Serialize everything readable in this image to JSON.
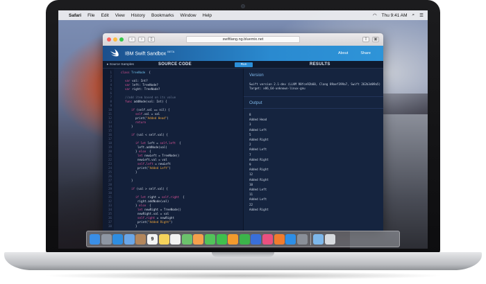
{
  "menubar": {
    "app_name": "Safari",
    "items": [
      "File",
      "Edit",
      "View",
      "History",
      "Bookmarks",
      "Window",
      "Help"
    ],
    "clock": "Thu 9:41 AM"
  },
  "safari": {
    "url": "swiftlang.ng.bluemix.net"
  },
  "sandbox": {
    "title": "IBM Swift Sandbox",
    "beta": "BETA",
    "nav": [
      "About",
      "Share"
    ],
    "samples_label": "Source Samples",
    "source_label": "SOURCE CODE",
    "run_label": "Run",
    "results_label": "RESULTS"
  },
  "code_lines": [
    {
      "n": "1",
      "t": [
        [
          "kw",
          "class "
        ],
        [
          "ty",
          "TreeNode"
        ],
        [
          "",
          "  {"
        ]
      ],
      "i": 2
    },
    {
      "n": "2",
      "t": [
        [
          "",
          ""
        ]
      ],
      "i": 0
    },
    {
      "n": "3",
      "t": [
        [
          "kw",
          "var "
        ],
        [
          "",
          "val: Int?"
        ]
      ],
      "i": 4
    },
    {
      "n": "4",
      "t": [
        [
          "kw",
          "var "
        ],
        [
          "",
          "left: TreeNode?"
        ]
      ],
      "i": 4
    },
    {
      "n": "5",
      "t": [
        [
          "kw",
          "var "
        ],
        [
          "",
          "right: TreeNode?"
        ]
      ],
      "i": 4
    },
    {
      "n": "6",
      "t": [
        [
          "",
          ""
        ]
      ],
      "i": 0
    },
    {
      "n": "7",
      "t": [
        [
          "cm",
          "//add item based on its value"
        ]
      ],
      "i": 4
    },
    {
      "n": "8",
      "t": [
        [
          "kw",
          "func "
        ],
        [
          "",
          "addNode(val: Int) {"
        ]
      ],
      "i": 4
    },
    {
      "n": "9",
      "t": [
        [
          "",
          ""
        ]
      ],
      "i": 0
    },
    {
      "n": "10",
      "t": [
        [
          "kw",
          "if "
        ],
        [
          "",
          "(self.val == nil) {"
        ]
      ],
      "i": 7
    },
    {
      "n": "11",
      "t": [
        [
          "sf",
          "self"
        ],
        [
          "",
          ".val = val"
        ]
      ],
      "i": 9
    },
    {
      "n": "12",
      "t": [
        [
          "",
          "print("
        ],
        [
          "st",
          "\"Added Head\""
        ],
        [
          "",
          ")"
        ]
      ],
      "i": 9
    },
    {
      "n": "13",
      "t": [
        [
          "kw",
          "return"
        ]
      ],
      "i": 9
    },
    {
      "n": "14",
      "t": [
        [
          "",
          "}"
        ]
      ],
      "i": 7
    },
    {
      "n": "15",
      "t": [
        [
          "",
          ""
        ]
      ],
      "i": 0
    },
    {
      "n": "16",
      "t": [
        [
          "kw",
          "if "
        ],
        [
          "",
          "(val < self.val) {"
        ]
      ],
      "i": 7
    },
    {
      "n": "17",
      "t": [
        [
          "",
          ""
        ]
      ],
      "i": 0
    },
    {
      "n": "18",
      "t": [
        [
          "kw",
          "if let "
        ],
        [
          "",
          "left = "
        ],
        [
          "sf",
          "self"
        ],
        [
          "",
          "."
        ],
        [
          "sf",
          "left"
        ],
        [
          "",
          "  {"
        ]
      ],
      "i": 9
    },
    {
      "n": "19",
      "t": [
        [
          "",
          "left.addNode(val)"
        ]
      ],
      "i": 10
    },
    {
      "n": "20",
      "t": [
        [
          "",
          "} "
        ],
        [
          "kw",
          "else"
        ],
        [
          "",
          "  {"
        ]
      ],
      "i": 9
    },
    {
      "n": "21",
      "t": [
        [
          "kw",
          "let "
        ],
        [
          "",
          "newLeft = TreeNode()"
        ]
      ],
      "i": 10
    },
    {
      "n": "22",
      "t": [
        [
          "",
          "newLeft.val = val"
        ]
      ],
      "i": 10
    },
    {
      "n": "23",
      "t": [
        [
          "sf",
          "self"
        ],
        [
          "",
          "."
        ],
        [
          "sf",
          "left"
        ],
        [
          "",
          ""
        ],
        [
          "",
          ""
        ],
        [
          "",
          ""
        ],
        [
          "",
          ""
        ]
      ],
      "i": 10,
      "suffix": " = newLeft"
    },
    {
      "n": "24",
      "t": [
        [
          "",
          "print("
        ],
        [
          "st",
          "\"Added Left\""
        ],
        [
          "",
          ")"
        ]
      ],
      "i": 10
    },
    {
      "n": "25",
      "t": [
        [
          "",
          "}"
        ]
      ],
      "i": 9
    },
    {
      "n": "26",
      "t": [
        [
          "",
          ""
        ]
      ],
      "i": 0
    },
    {
      "n": "27",
      "t": [
        [
          "",
          "}"
        ]
      ],
      "i": 7
    },
    {
      "n": "28",
      "t": [
        [
          "",
          ""
        ]
      ],
      "i": 0
    },
    {
      "n": "29",
      "t": [
        [
          "kw",
          "if "
        ],
        [
          "",
          "(val > self.val) {"
        ]
      ],
      "i": 7
    },
    {
      "n": "30",
      "t": [
        [
          "",
          ""
        ]
      ],
      "i": 0
    },
    {
      "n": "31",
      "t": [
        [
          "kw",
          "if let "
        ],
        [
          "",
          "right = "
        ],
        [
          "sf",
          "self"
        ],
        [
          "",
          "."
        ],
        [
          "sf",
          "right"
        ],
        [
          "",
          "  {"
        ]
      ],
      "i": 9
    },
    {
      "n": "32",
      "t": [
        [
          "",
          "right.addNode(val)"
        ]
      ],
      "i": 10
    },
    {
      "n": "33",
      "t": [
        [
          "",
          "} "
        ],
        [
          "kw",
          "else"
        ],
        [
          "",
          "  {"
        ]
      ],
      "i": 9
    },
    {
      "n": "34",
      "t": [
        [
          "kw",
          "let "
        ],
        [
          "",
          "newRight = TreeNode()"
        ]
      ],
      "i": 10
    },
    {
      "n": "35",
      "t": [
        [
          "",
          "newRight.val = val"
        ]
      ],
      "i": 10
    },
    {
      "n": "36",
      "t": [
        [
          "sf",
          "self"
        ],
        [
          "",
          "."
        ],
        [
          "sf",
          "right"
        ],
        [
          "",
          ""
        ]
      ],
      "i": 10,
      "suffix": " = newRight"
    },
    {
      "n": "37",
      "t": [
        [
          "",
          "print("
        ],
        [
          "st",
          "\"Added Right\""
        ],
        [
          "",
          ")"
        ]
      ],
      "i": 10
    },
    {
      "n": "38",
      "t": [
        [
          "",
          "}"
        ]
      ],
      "i": 9
    }
  ],
  "results": {
    "version_heading": "Version",
    "version_lines": [
      "Swift version 2.1-dev (LLVM 98fce92b60, Clang 89aef399a7, Swift 262b3d09a5)",
      "Target: x86_64-unknown-linux-gnu"
    ],
    "output_heading": "Output",
    "output_lines": [
      "8",
      "Added Head",
      "3",
      "Added Left",
      "5",
      "Added Right",
      "2",
      "Added Left",
      "7",
      "Added Right",
      "9",
      "Added Right",
      "12",
      "Added Right",
      "10",
      "Added Left",
      "11",
      "Added Left",
      "22",
      "Added Right"
    ]
  },
  "dock": {
    "icons": [
      {
        "name": "finder-icon",
        "color": "#3a8ee6"
      },
      {
        "name": "launchpad-icon",
        "color": "#8e96a3"
      },
      {
        "name": "safari-icon",
        "color": "#2f8de0"
      },
      {
        "name": "mail-icon",
        "color": "#6aa6e8"
      },
      {
        "name": "contacts-icon",
        "color": "#b3865c"
      },
      {
        "name": "calendar-icon",
        "color": "#f4f4f4",
        "glyph": "9",
        "glyph_color": "#222"
      },
      {
        "name": "notes-icon",
        "color": "#f6d35b"
      },
      {
        "name": "reminders-icon",
        "color": "#f2f2f2"
      },
      {
        "name": "maps-icon",
        "color": "#6cc26c"
      },
      {
        "name": "photos-icon",
        "color": "#f5a04c"
      },
      {
        "name": "messages-icon",
        "color": "#52c35a"
      },
      {
        "name": "facetime-icon",
        "color": "#3fbf4d"
      },
      {
        "name": "pages-icon",
        "color": "#f39a2e"
      },
      {
        "name": "numbers-icon",
        "color": "#3cb34a"
      },
      {
        "name": "keynote-icon",
        "color": "#3a6fd8"
      },
      {
        "name": "itunes-icon",
        "color": "#e9507f"
      },
      {
        "name": "ibooks-icon",
        "color": "#f07c2e"
      },
      {
        "name": "app-store-icon",
        "color": "#2d8ee6"
      },
      {
        "name": "system-preferences-icon",
        "color": "#8a8f98"
      },
      {
        "name": "downloads-folder-icon",
        "color": "#7db7ea"
      },
      {
        "name": "trash-icon",
        "color": "#d7dade"
      }
    ]
  }
}
